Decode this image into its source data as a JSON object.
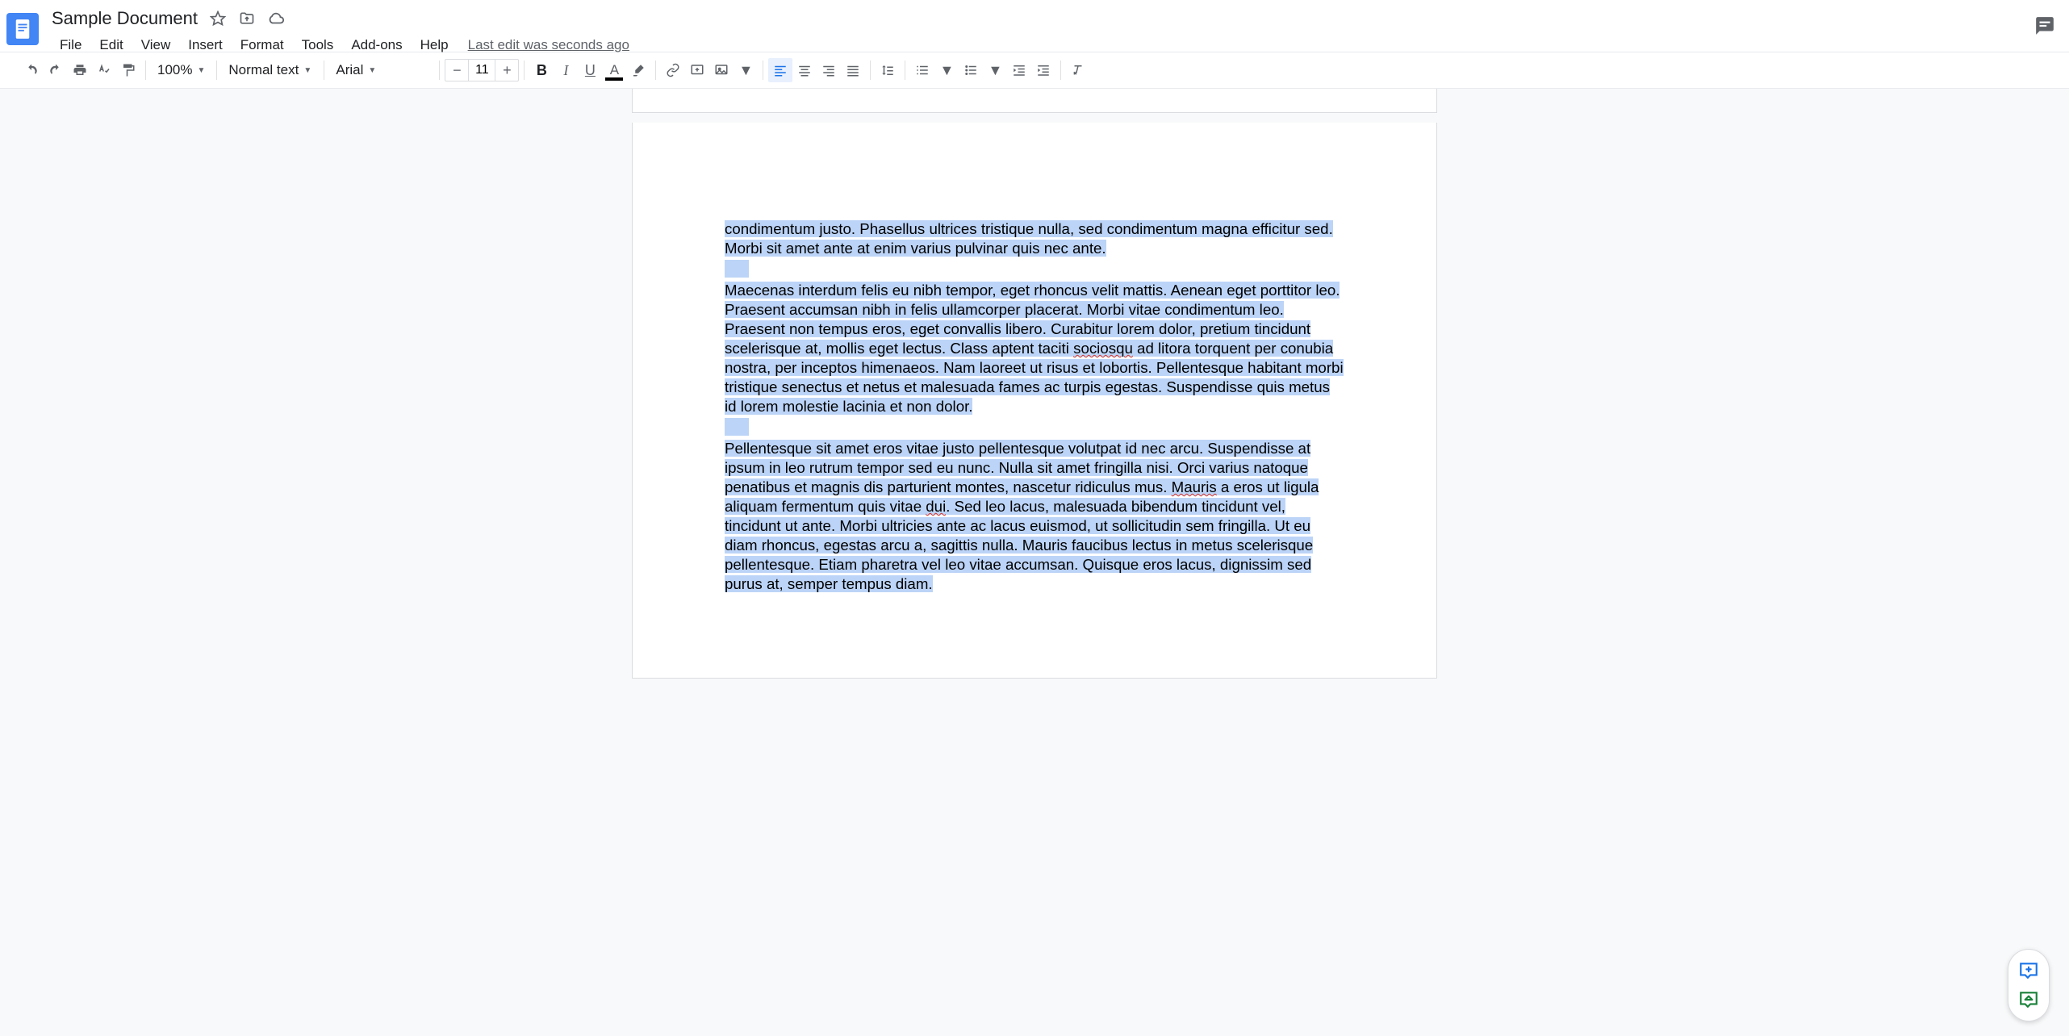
{
  "header": {
    "doc_title": "Sample Document",
    "last_edit": "Last edit was seconds ago"
  },
  "menus": [
    "File",
    "Edit",
    "View",
    "Insert",
    "Format",
    "Tools",
    "Add-ons",
    "Help"
  ],
  "toolbar": {
    "zoom": "100%",
    "paragraph_style": "Normal text",
    "font_family": "Arial",
    "font_size": "11"
  },
  "document": {
    "para1": "condimentum justo. Phasellus ultrices tristique nulla, sed condimentum magna efficitur sed. Morbi sit amet ante at enim varius pulvinar quis nec ante.",
    "para2_a": "Maecenas interdum felis eu nibh tempor, eget rhoncus velit mattis. Aenean eget porttitor leo. Praesent accumsan nibh in felis ullamcorper placerat. Morbi vitae condimentum leo. Praesent non tempus eros, eget convallis libero. Curabitur lorem dolor, pretium tincidunt scelerisque at, mollis eget lectus. Class aptent taciti ",
    "para2_sq1": "sociosqu",
    "para2_b": " ad litora torquent per conubia nostra, per inceptos himenaeos. Nam laoreet ut risus et lobortis. Pellentesque habitant morbi tristique senectus et netus et malesuada fames ac turpis egestas. Suspendisse quis metus id lorem molestie lacinia et non dolor.",
    "para3_a": "Pellentesque sit amet eros vitae justo pellentesque volutpat id nec arcu. Suspendisse at ipsum in leo rutrum tempor sed eu nunc. Nulla sit amet fringilla nisi. Orci varius natoque penatibus et magnis dis parturient montes, nascetur ridiculus mus. ",
    "para3_sq1": "Mauris",
    "para3_b": " a eros ut ligula aliquam fermentum quis vitae ",
    "para3_sq2": "dui",
    "para3_c": ". Sed leo lacus, malesuada bibendum tincidunt vel, tincidunt ut ante. Morbi ultricies ante ac lacus euismod, ut sollicitudin sem fringilla. Ut eu diam rhoncus, egestas arcu a, sagittis nulla. Mauris faucibus lectus in metus scelerisque pellentesque. Etiam pharetra vel leo vitae accumsan. Quisque eros lacus, dignissim sed purus at, semper tempus diam."
  }
}
